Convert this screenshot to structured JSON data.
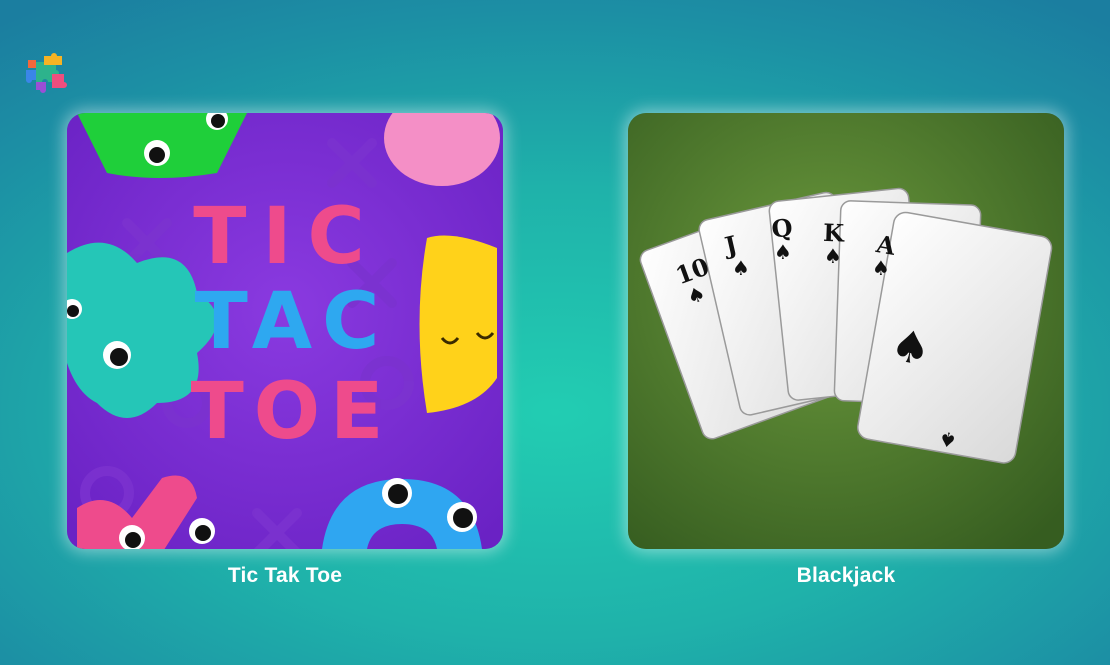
{
  "header": {
    "logo_icon": "puzzle-logo-icon"
  },
  "games": [
    {
      "title": "Tic Tak Toe",
      "art_text": [
        "TIC",
        "TAC",
        "TOE"
      ],
      "art_icon": "tic-tac-toe-art",
      "colors": {
        "background": "#7a2fd0",
        "letters_pink": "#ee4b8c",
        "letters_blue": "#2ea8f0"
      }
    },
    {
      "title": "Blackjack",
      "art_icon": "playing-cards-art",
      "card_ranks": [
        "10",
        "J",
        "Q",
        "K",
        "A"
      ],
      "colors": {
        "felt": "#4f7a2e"
      }
    }
  ]
}
